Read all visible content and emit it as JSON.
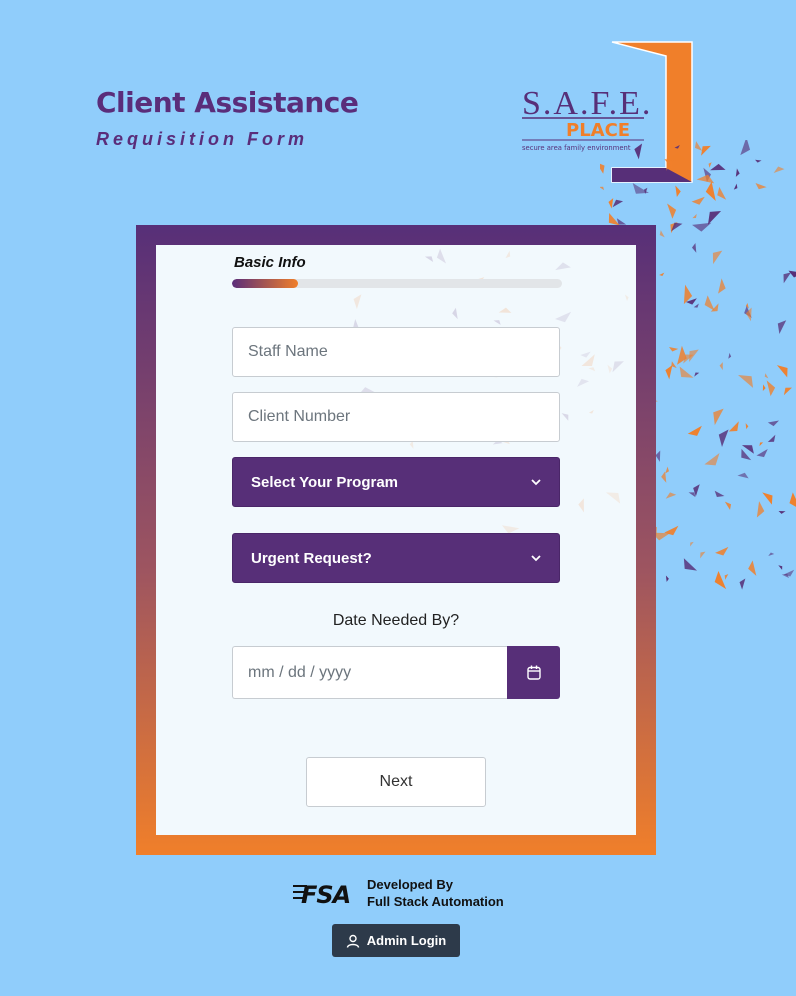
{
  "header": {
    "title": "Client Assistance",
    "subtitle": "Requisition Form"
  },
  "logo": {
    "wordmark": "S.A.F.E.",
    "place": "PLACE",
    "tagline": "secure area family environment"
  },
  "form": {
    "step_label": "Basic Info",
    "progress_percent": 20,
    "staff_name_placeholder": "Staff Name",
    "client_number_placeholder": "Client Number",
    "program_select": "Select Your Program",
    "urgent_select": "Urgent Request?",
    "date_label": "Date Needed By?",
    "date_placeholder": "mm / dd / yyyy",
    "next_label": "Next"
  },
  "footer": {
    "developed_by": "Developed By",
    "company": "Full Stack Automation",
    "fsa_mark": "FSA",
    "admin_label": "Admin Login"
  },
  "colors": {
    "background": "#90cdfb",
    "purple": "#572f78",
    "orange": "#f07f2a"
  },
  "icons": [
    "chevron-down-icon",
    "calendar-icon",
    "user-icon"
  ]
}
